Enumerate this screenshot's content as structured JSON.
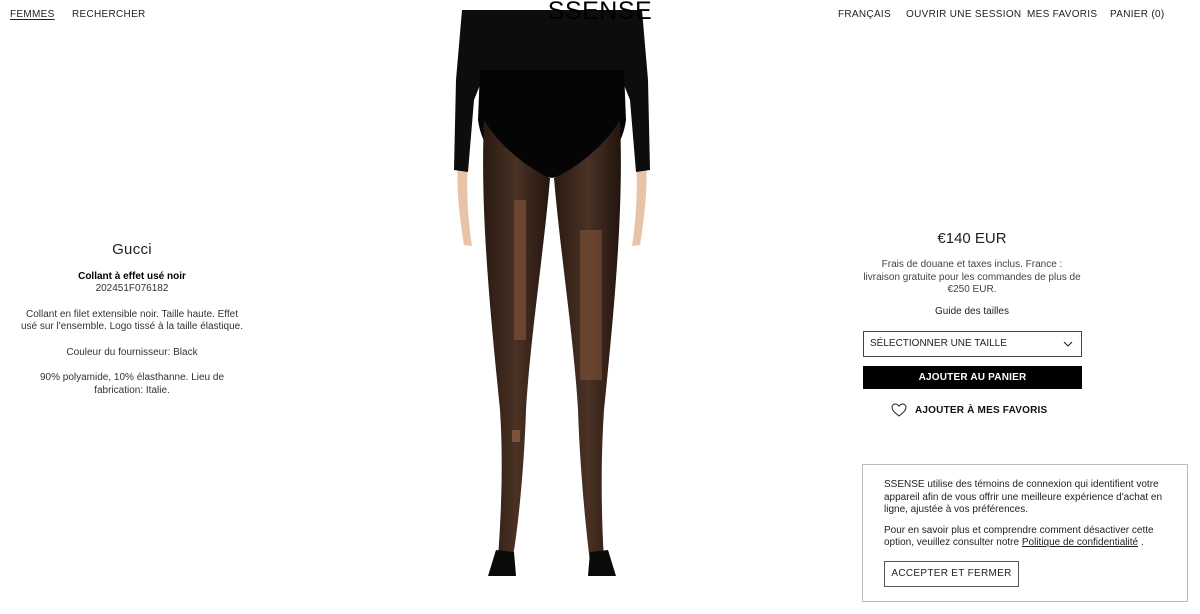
{
  "header": {
    "nav_left": {
      "women": "FEMMES",
      "search": "RECHERCHER"
    },
    "logo": "SSENSE",
    "nav_right": {
      "language": "FRANÇAIS",
      "login": "OUVRIR UNE SESSION",
      "wishlist": "MES FAVORIS",
      "cart": "PANIER (0)"
    }
  },
  "product": {
    "brand": "Gucci",
    "name": "Collant à effet usé noir",
    "sku": "202451F076182",
    "description": "Collant en filet extensible noir. Taille haute. Effet usé sur l'ensemble. Logo tissé à la taille élastique.",
    "supplier_color": "Couleur du fournisseur: Black",
    "composition": "90% polyamide, 10% élasthanne. Lieu de fabrication: Italie."
  },
  "purchase": {
    "price": "€140 EUR",
    "shipping_note": "Frais de douane et taxes inclus. France : livraison gratuite pour les commandes de plus de €250 EUR.",
    "size_guide": "Guide des tailles",
    "size_select": "SÉLECTIONNER UNE TAILLE",
    "add_to_cart": "AJOUTER AU PANIER",
    "add_to_wishlist": "AJOUTER À MES FAVORIS"
  },
  "cookie_banner": {
    "text_1": "SSENSE utilise des témoins de connexion qui identifient votre appareil afin de vous offrir une meilleure expérience d'achat en ligne, ajustée à vos préférences.",
    "text_2_prefix": "Pour en savoir plus et comprendre comment désactiver cette option, veuillez consulter notre ",
    "privacy_link": "Politique de confidentialité",
    "text_2_suffix": " .",
    "accept_button": "ACCEPTER ET FERMER"
  },
  "icons": {
    "chevron": "chevron-down-icon",
    "heart": "heart-icon"
  },
  "colors": {
    "accent": "#000000",
    "button_text": "#ffffff",
    "text": "#222222"
  }
}
